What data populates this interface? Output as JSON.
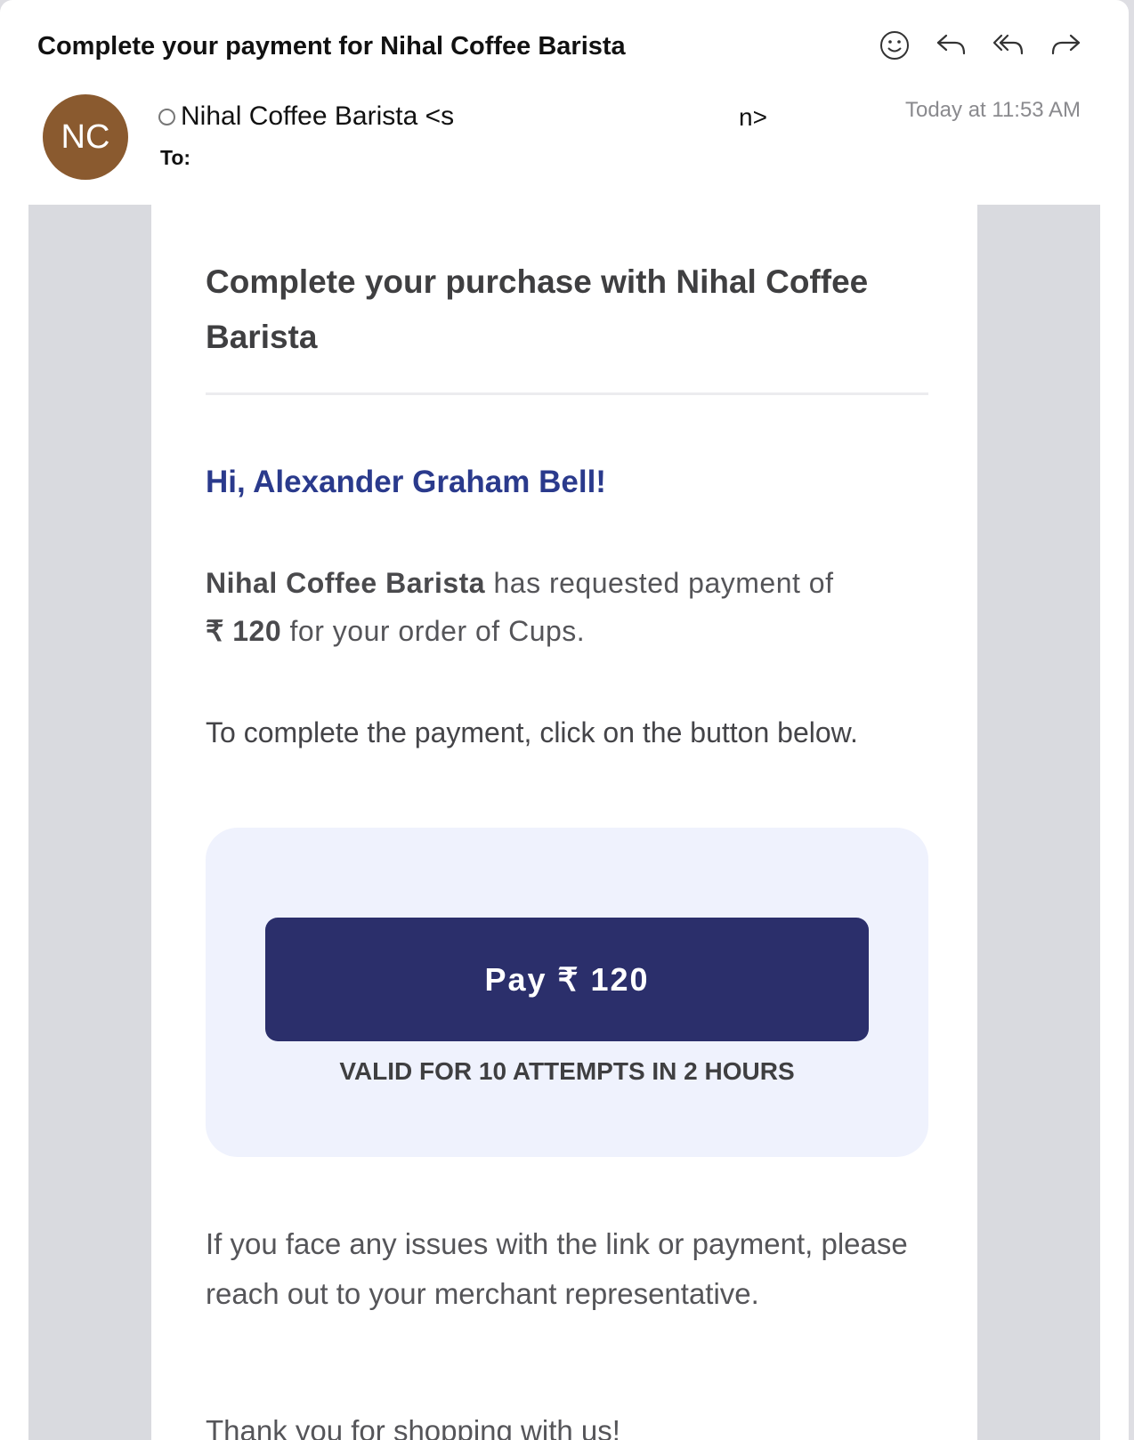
{
  "header": {
    "subject": "Complete your payment for Nihal Coffee Barista",
    "toolbar": [
      {
        "name": "emoji-icon",
        "label": "React"
      },
      {
        "name": "reply-icon",
        "label": "Reply"
      },
      {
        "name": "reply-all-icon",
        "label": "Reply All"
      },
      {
        "name": "forward-icon",
        "label": "Forward"
      }
    ]
  },
  "sender": {
    "initials": "NC",
    "name_start": "Nihal Coffee Barista <s",
    "name_end": "n>",
    "to_label": "To:",
    "timestamp": "Today at 11:53 AM",
    "avatar_color": "#8a5a2f"
  },
  "email": {
    "title": "Complete your purchase with Nihal Coffee Barista",
    "greeting": "Hi, Alexander Graham Bell!",
    "merchant": "Nihal Coffee Barista",
    "request_text": " has requested payment of",
    "amount": "₹ 120",
    "order_text": " for your order of Cups.",
    "instruction": "To complete the payment, click on the button below.",
    "pay_button": "Pay ₹ 120",
    "validity": "VALID FOR 10 ATTEMPTS IN 2 HOURS",
    "support_text": "If you face any issues with the link or payment, please reach out to your merchant representative.",
    "closing": "Thank you for shopping with us!",
    "colors": {
      "button": "#2b2f6b",
      "greeting": "#2a3a8c",
      "pay_box": "#eff2fd"
    }
  }
}
